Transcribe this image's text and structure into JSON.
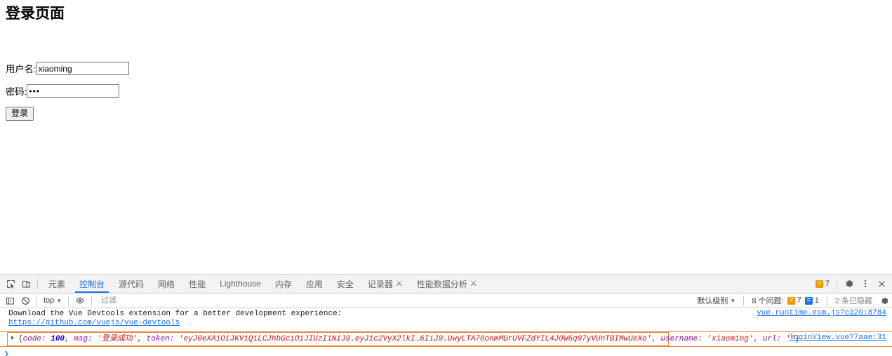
{
  "page": {
    "title": "登录页面",
    "fields": [
      {
        "label": "用户名:",
        "value": "xiaoming",
        "name": "username"
      },
      {
        "label": "密码:",
        "value": "•••",
        "name": "password"
      }
    ],
    "submit_label": "登录"
  },
  "devtools": {
    "tabs": [
      {
        "label": "元素",
        "active": false,
        "experimental": false
      },
      {
        "label": "控制台",
        "active": true,
        "experimental": false
      },
      {
        "label": "源代码",
        "active": false,
        "experimental": false
      },
      {
        "label": "网络",
        "active": false,
        "experimental": false
      },
      {
        "label": "性能",
        "active": false,
        "experimental": false
      },
      {
        "label": "Lighthouse",
        "active": false,
        "experimental": false
      },
      {
        "label": "内存",
        "active": false,
        "experimental": false
      },
      {
        "label": "应用",
        "active": false,
        "experimental": false
      },
      {
        "label": "安全",
        "active": false,
        "experimental": false
      },
      {
        "label": "记录器",
        "active": false,
        "experimental": true
      },
      {
        "label": "性能数据分析",
        "active": false,
        "experimental": true
      }
    ],
    "tab_warning_count": "7",
    "console_bar": {
      "context": "top",
      "filter_placeholder": "过滤",
      "filter_value": "",
      "level": "默认级别",
      "issues_label": "8 个问题:",
      "issues_warnings": "7",
      "issues_info": "1",
      "hidden_note": "2 条已隐藏"
    },
    "messages": [
      {
        "type": "vue-devtools",
        "line1": "Download the Vue Devtools extension for a better development experience:",
        "link": "https://github.com/vuejs/vue-devtools",
        "source": "vue.runtime.esm.js?c320:8784"
      },
      {
        "type": "object",
        "prefix": "{",
        "parts": [
          {
            "key": "code: ",
            "value": "100",
            "kind": "num",
            "sep": ", "
          },
          {
            "key": "msg: ",
            "value": "'登录成功'",
            "kind": "str",
            "sep": ", "
          },
          {
            "key": "token: ",
            "value": "'eyJ0eXAiOiJKV1QiLCJhbGciOiJIUzI1NiJ9.eyJ1c2VyX2lkI…6IiJ9.UwyLTA78onmMUrUVFZdYIL4J0W6q97yVUnTBIMwUeXo'",
            "kind": "str",
            "sep": ", "
          },
          {
            "key": "username: ",
            "value": "'xiaoming'",
            "kind": "str",
            "sep": ", "
          },
          {
            "key": "url: ",
            "value": "''",
            "kind": "str",
            "sep": ""
          }
        ],
        "suffix": "}",
        "source": "loginView.vue?7aae:31"
      }
    ],
    "prompt_caret": "❯"
  },
  "colors": {
    "accent": "#1a73e8",
    "warning": "#f29900",
    "object_border": "#e8853a",
    "string": "#c41a16",
    "number": "#1c00cf",
    "property": "#881391"
  }
}
